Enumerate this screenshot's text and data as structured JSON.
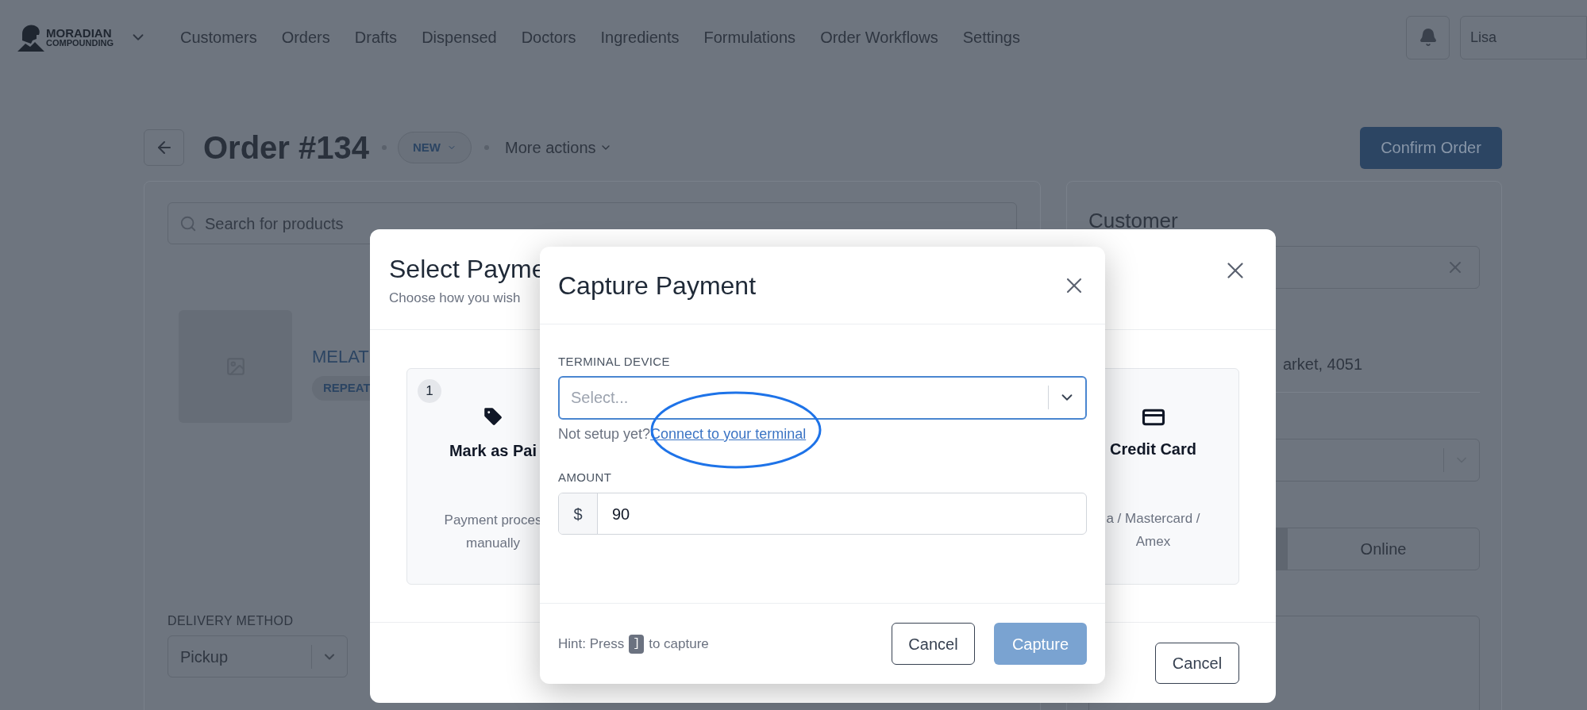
{
  "nav": {
    "logo": {
      "line1": "MORADIAN",
      "line2": "COMPOUNDING"
    },
    "items": [
      "Customers",
      "Orders",
      "Drafts",
      "Dispensed",
      "Doctors",
      "Ingredients",
      "Formulations",
      "Order Workflows",
      "Settings"
    ],
    "user_field": "Lisa"
  },
  "order": {
    "title": "Order #134",
    "status": "NEW",
    "more_actions": "More actions",
    "confirm": "Confirm Order"
  },
  "products": {
    "search_placeholder": "Search for products",
    "item": {
      "name": "MELAT",
      "badge": "REPEAT"
    },
    "delivery": {
      "label": "DELIVERY METHOD",
      "value": "Pickup"
    }
  },
  "customer": {
    "heading": "Customer",
    "address": "arket, 4051",
    "toggle_option": {
      "label": "Online",
      "selected": false
    }
  },
  "select_payment": {
    "title": "Select Payme",
    "subtitle": "Choose how you wish",
    "methods": [
      {
        "kind": "tag",
        "number": "1",
        "title": "Mark as Pai",
        "description": [
          "Payment proces",
          "manually"
        ]
      },
      {
        "kind": "card",
        "title": "Credit Card",
        "description": [
          "a / Mastercard /",
          "Amex"
        ]
      }
    ],
    "cancel": "Cancel"
  },
  "capture": {
    "title": "Capture Payment",
    "terminal_label": "TERMINAL DEVICE",
    "terminal_placeholder": "Select...",
    "terminal_focused": true,
    "setup_note": "Not setup yet?",
    "setup_link": "Connect to your terminal",
    "amount_label": "AMOUNT",
    "currency": "$",
    "amount": "90",
    "hint_before": "Hint: Press",
    "hint_key": "]",
    "hint_after": "to capture",
    "cancel": "Cancel",
    "capture": "Capture",
    "capture_disabled": true
  }
}
